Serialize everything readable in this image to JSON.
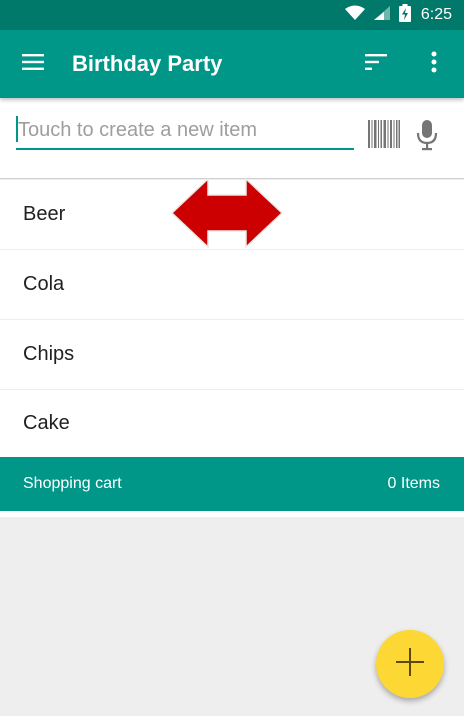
{
  "status_bar": {
    "time": "6:25",
    "icons": [
      "wifi-icon",
      "signal-icon",
      "battery-charging-icon"
    ]
  },
  "toolbar": {
    "title": "Birthday Party",
    "icons": [
      "menu-icon",
      "sort-icon",
      "more-vert-icon"
    ]
  },
  "new_item": {
    "placeholder": "Touch to create a new item",
    "value": "",
    "icons": [
      "barcode-icon",
      "mic-icon"
    ]
  },
  "list": {
    "items": [
      {
        "label": "Beer"
      },
      {
        "label": "Cola"
      },
      {
        "label": "Chips"
      },
      {
        "label": "Cake"
      }
    ]
  },
  "cart": {
    "label": "Shopping cart",
    "count": "0 Items"
  },
  "fab": {
    "icon": "add-icon"
  },
  "colors": {
    "primary": "#009688",
    "primary_dark": "#00796b",
    "accent": "#fdd835",
    "drag_arrow": "#cc0000",
    "background": "#eeeeee"
  }
}
